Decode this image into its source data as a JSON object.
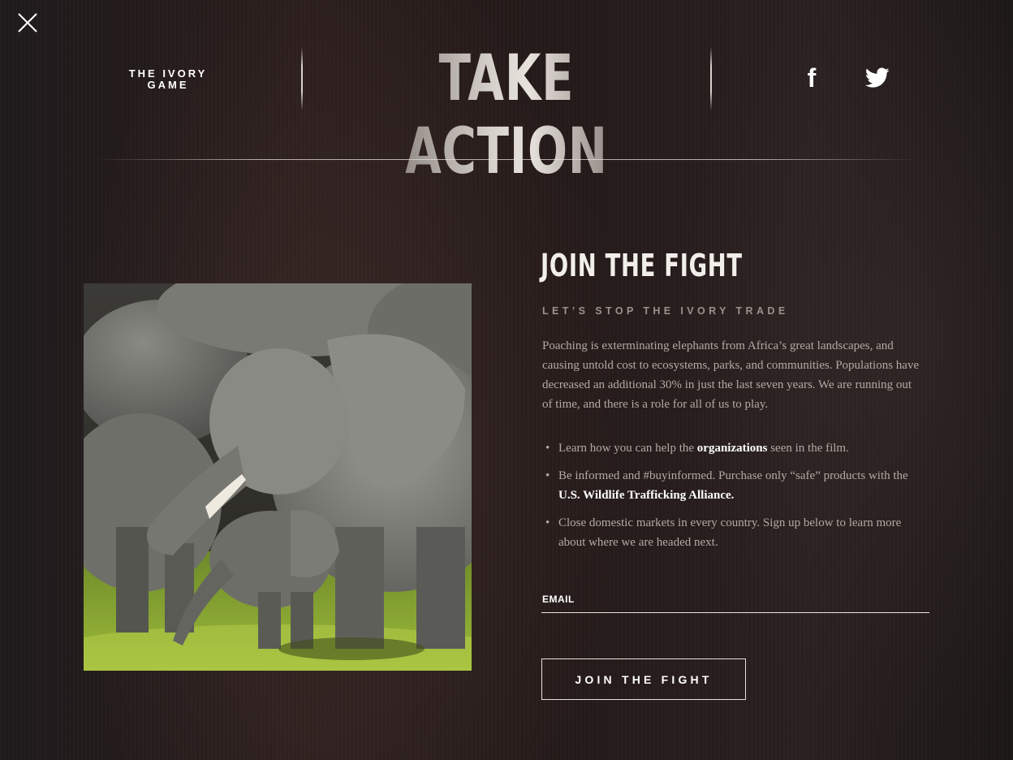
{
  "header": {
    "close_icon": "close-icon",
    "brand": "THE IVORY GAME",
    "title": "TAKE ACTION",
    "social": [
      {
        "name": "facebook-icon",
        "glyph": "f"
      },
      {
        "name": "twitter-icon"
      }
    ]
  },
  "main": {
    "heading": "JOIN THE FIGHT",
    "subheading": "LET’S STOP THE IVORY TRADE",
    "paragraph": "Poaching is exterminating elephants from Africa’s great landscapes, and causing untold cost to ecosystems, parks, and communities. Populations have decreased an additional 30% in just the last seven years. We are running out of time, and there is a role for all of us to play.",
    "bullets": [
      {
        "before": "Learn how you can help the ",
        "link": "organizations",
        "after": " seen in the film."
      },
      {
        "before": "Be informed and #buyinformed. Purchase only “safe” products with the ",
        "link": "U.S. Wildlife Trafficking Alliance.",
        "after": ""
      },
      {
        "before": "Close domestic markets in every country. Sign up below to learn more about where we are headed next.",
        "link": "",
        "after": ""
      }
    ],
    "email": {
      "label": "EMAIL",
      "value": "",
      "placeholder": ""
    },
    "submit_label": "JOIN THE FIGHT"
  },
  "colors": {
    "background": "#1a1414",
    "heading": "#f2eeea",
    "body_text": "#b3aaa5",
    "link": "#ffffff"
  }
}
